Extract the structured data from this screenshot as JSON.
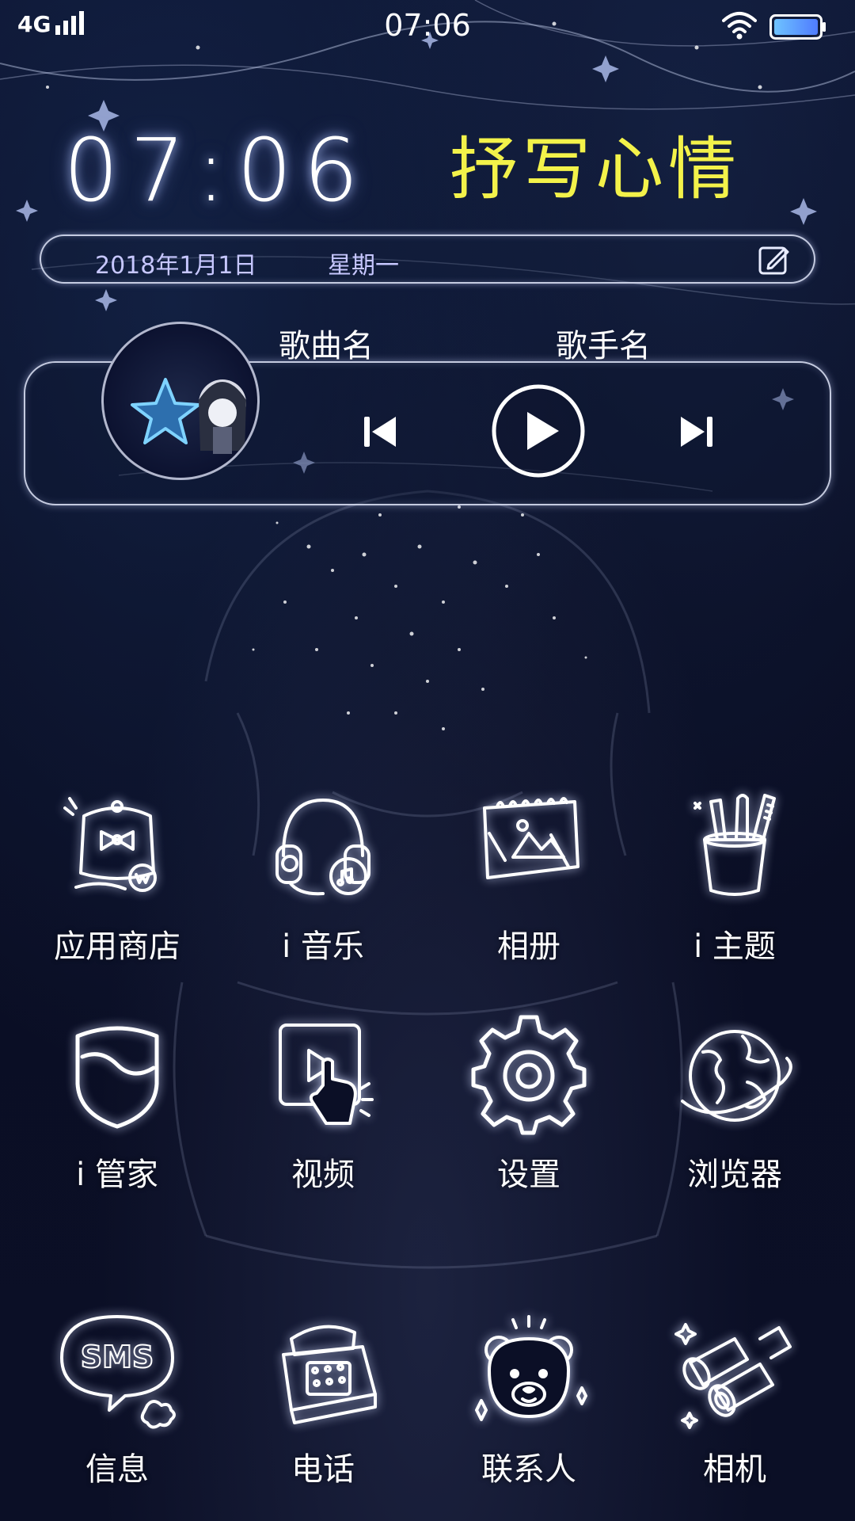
{
  "status_bar": {
    "network": "4G",
    "time": "07:06",
    "icons": [
      "signal-icon",
      "wifi-icon",
      "battery-icon"
    ]
  },
  "clock_widget": {
    "big_time": "07:06",
    "mood_title": "抒写心情",
    "date": "2018年1月1日",
    "weekday": "星期一",
    "mood_title_color": "#f3f24a",
    "date_text_color": "#c7c7ff"
  },
  "music_widget": {
    "song_name": "歌曲名",
    "artist_name": "歌手名",
    "controls": [
      "previous-icon",
      "play-icon",
      "next-icon"
    ]
  },
  "apps": [
    {
      "label": "应用商店",
      "icon": "app-store-icon"
    },
    {
      "label": "i 音乐",
      "icon": "headphones-icon"
    },
    {
      "label": "相册",
      "icon": "photo-album-icon"
    },
    {
      "label": "i 主题",
      "icon": "pencil-cup-icon"
    },
    {
      "label": "i 管家",
      "icon": "shield-icon"
    },
    {
      "label": "视频",
      "icon": "video-touch-icon"
    },
    {
      "label": "设置",
      "icon": "gear-icon"
    },
    {
      "label": "浏览器",
      "icon": "globe-icon"
    },
    {
      "label": "信息",
      "icon": "sms-bubble-icon"
    },
    {
      "label": "电话",
      "icon": "telephone-icon"
    },
    {
      "label": "联系人",
      "icon": "bear-icon"
    },
    {
      "label": "相机",
      "icon": "binoculars-icon"
    }
  ],
  "theme": {
    "background": "#0b0f26",
    "glow": "#dfe4ff"
  }
}
